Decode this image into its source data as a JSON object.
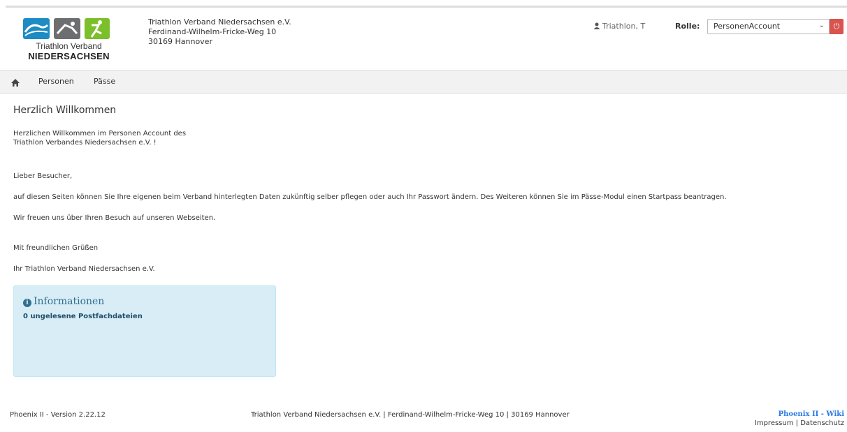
{
  "brand": {
    "logo_line1": "Triathlon Verband",
    "logo_line2": "NIEDERSACHSEN",
    "colors": {
      "blue": "#1e8bc3",
      "grey": "#6d6e70",
      "green": "#7bbf2a"
    }
  },
  "address": {
    "line1": "Triathlon Verband Niedersachsen e.V.",
    "line2": "Ferdinand-Wilhelm-Fricke-Weg 10",
    "line3": "30169 Hannover"
  },
  "user": {
    "name": "Triathlon, T",
    "rolle_label": "Rolle:",
    "rolle_value": "PersonenAccount",
    "user_icon": "user-icon",
    "logout_icon": "power-icon"
  },
  "nav": {
    "home_icon": "home-icon",
    "items": [
      "Personen",
      "Pässe"
    ]
  },
  "content": {
    "heading": "Herzlich Willkommen",
    "intro_line1": "Herzlichen Willkommen im Personen Account des",
    "intro_line2": "Triathlon Verbandes Niedersachsen e.V. !",
    "greeting": "Lieber Besucher,",
    "para1": "auf diesen Seiten können Sie Ihre eigenen beim Verband hinterlegten Daten zukünftig selber pflegen oder auch Ihr Passwort ändern. Des Weiteren können Sie im Pässe-Modul einen Startpass beantragen.",
    "para2": "Wir freuen uns über Ihren Besuch auf unseren Webseiten.",
    "closing": "Mit freundlichen Grüßen",
    "signature": "Ihr Triathlon Verband Niedersachsen e.V."
  },
  "info": {
    "title": "Informationen",
    "icon": "info-icon",
    "message": "0 ungelesene Postfachdateien"
  },
  "footer": {
    "version": "Phoenix II - Version 2.22.12",
    "center": "Triathlon Verband Niedersachsen e.V. | Ferdinand-Wilhelm-Fricke-Weg 10 | 30169 Hannover",
    "wiki": "Phoenix II - Wiki",
    "links": "Impressum | Datenschutz"
  }
}
